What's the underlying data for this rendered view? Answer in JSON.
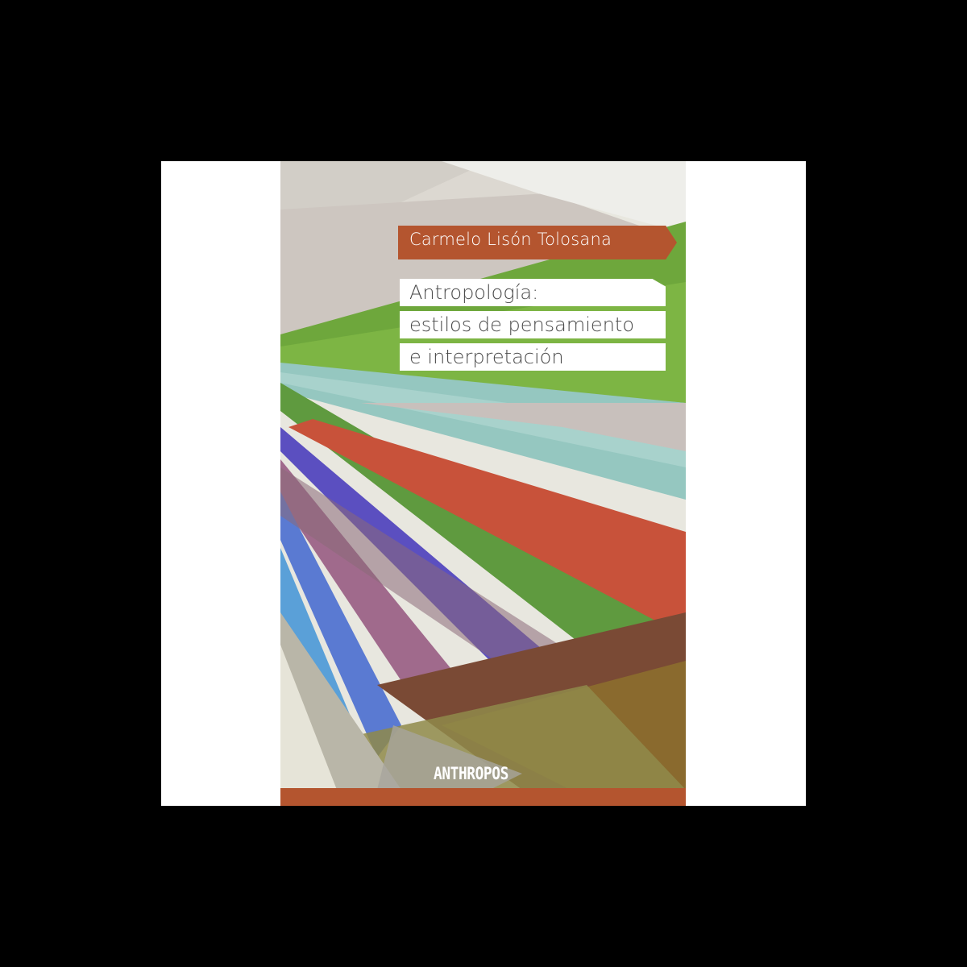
{
  "book": {
    "author": "Carmelo Lisón Tolosana",
    "title_lines": [
      "Antropología:",
      "estilos de pensamiento",
      "e interpretación"
    ],
    "publisher": "ANTHROPOS"
  },
  "colors": {
    "background": "#000000",
    "frame": "#ffffff",
    "accent_band": "#b4552f",
    "green": "#6fa93a",
    "teal": "#8fc8c4",
    "red": "#c4553a",
    "blue": "#4a62c8"
  }
}
